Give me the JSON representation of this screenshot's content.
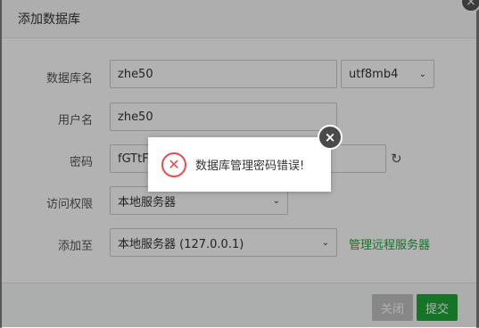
{
  "dialog": {
    "title": "添加数据库"
  },
  "form": {
    "db_name_label": "数据库名",
    "db_name_value": "zhe50",
    "charset_value": "utf8mb4",
    "user_label": "用户名",
    "user_value": "zhe50",
    "password_label": "密码",
    "password_value": "fGTtFi",
    "access_label": "访问权限",
    "access_value": "本地服务器",
    "add_to_label": "添加至",
    "add_to_value": "本地服务器 (127.0.0.1)",
    "manage_remote_link": "管理远程服务器"
  },
  "footer": {
    "close_label": "关闭",
    "submit_label": "提交"
  },
  "alert": {
    "message": "数据库管理密码错误!",
    "icon": "error-x-icon",
    "color": "#e64a4a"
  },
  "icons": {
    "close": "×",
    "chevron": "⌄",
    "refresh": "↻",
    "error": "✕"
  },
  "colors": {
    "accent": "#20a53a",
    "disabled": "#c2c2c2"
  }
}
